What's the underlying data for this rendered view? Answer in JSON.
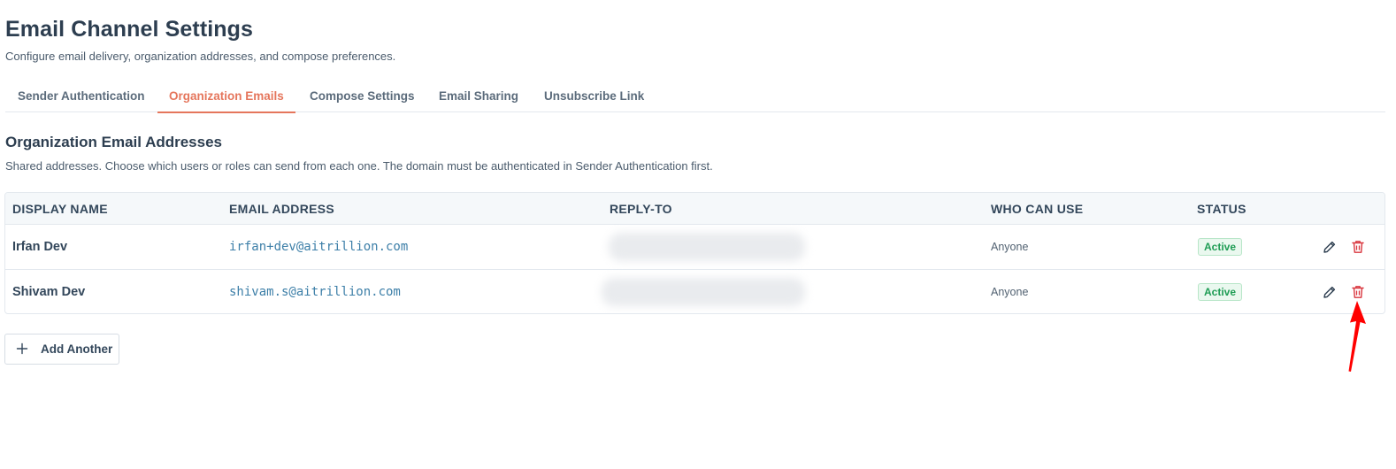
{
  "page": {
    "title": "Email Channel Settings",
    "subtitle": "Configure email delivery, organization addresses, and compose preferences."
  },
  "tabs": [
    {
      "label": "Sender Authentication",
      "active": false
    },
    {
      "label": "Organization Emails",
      "active": true
    },
    {
      "label": "Compose Settings",
      "active": false
    },
    {
      "label": "Email Sharing",
      "active": false
    },
    {
      "label": "Unsubscribe Link",
      "active": false
    }
  ],
  "section": {
    "title": "Organization Email Addresses",
    "description": "Shared addresses. Choose which users or roles can send from each one. The domain must be authenticated in Sender Authentication first."
  },
  "table": {
    "columns": [
      "DISPLAY NAME",
      "EMAIL ADDRESS",
      "REPLY-TO",
      "WHO CAN USE",
      "STATUS"
    ],
    "rows": [
      {
        "display_name": "Irfan Dev",
        "email": "irfan+dev@aitrillion.com",
        "who_can_use": "Anyone",
        "status": "Active"
      },
      {
        "display_name": "Shivam Dev",
        "email": "shivam.s@aitrillion.com",
        "who_can_use": "Anyone",
        "status": "Active"
      }
    ]
  },
  "actions": {
    "add_label": "Add Another"
  },
  "icons": {
    "edit": "pencil-icon",
    "delete": "trash-icon",
    "add": "plus-icon",
    "annotation": "red-arrow-icon"
  },
  "colors": {
    "accent": "#e5765c",
    "link": "#3d7fa8",
    "success": "#1f9d55",
    "danger": "#d9363e",
    "annotation": "#ff0000"
  }
}
